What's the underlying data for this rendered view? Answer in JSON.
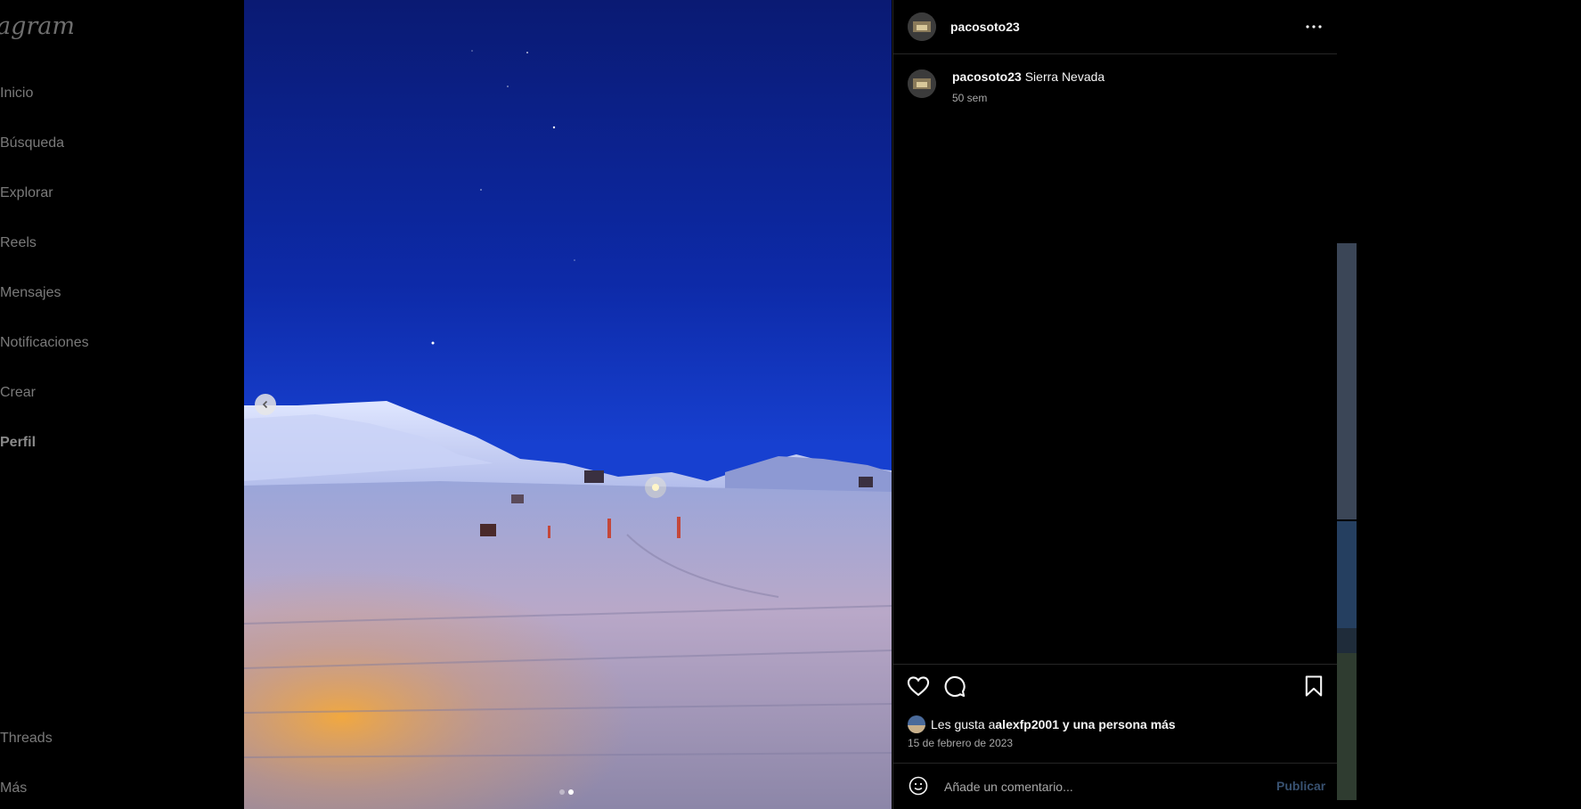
{
  "sidebar": {
    "logo_text": "agram",
    "items": [
      {
        "label": "Inicio"
      },
      {
        "label": "Búsqueda"
      },
      {
        "label": "Explorar"
      },
      {
        "label": "Reels"
      },
      {
        "label": "Mensajes"
      },
      {
        "label": "Notificaciones"
      },
      {
        "label": "Crear"
      },
      {
        "label": "Perfil"
      }
    ],
    "bottom_items": [
      {
        "label": "Threads"
      },
      {
        "label": "Más"
      }
    ]
  },
  "post": {
    "author": "pacosoto23",
    "caption": "Sierra Nevada",
    "posted_ago": "50 sem",
    "likes_prefix": "Les gusta a ",
    "likes_user": "alexfp2001",
    "likes_suffix": " y una persona más",
    "date": "15 de febrero de 2023",
    "carousel": {
      "total": 2,
      "current": 2
    }
  },
  "comment": {
    "placeholder": "Añade un comentario...",
    "publish_label": "Publicar"
  },
  "colors": {
    "background": "#000000",
    "text": "#f5f5f5",
    "muted": "#a8a8a8",
    "publish_disabled": "#385170",
    "divider": "#262626"
  }
}
